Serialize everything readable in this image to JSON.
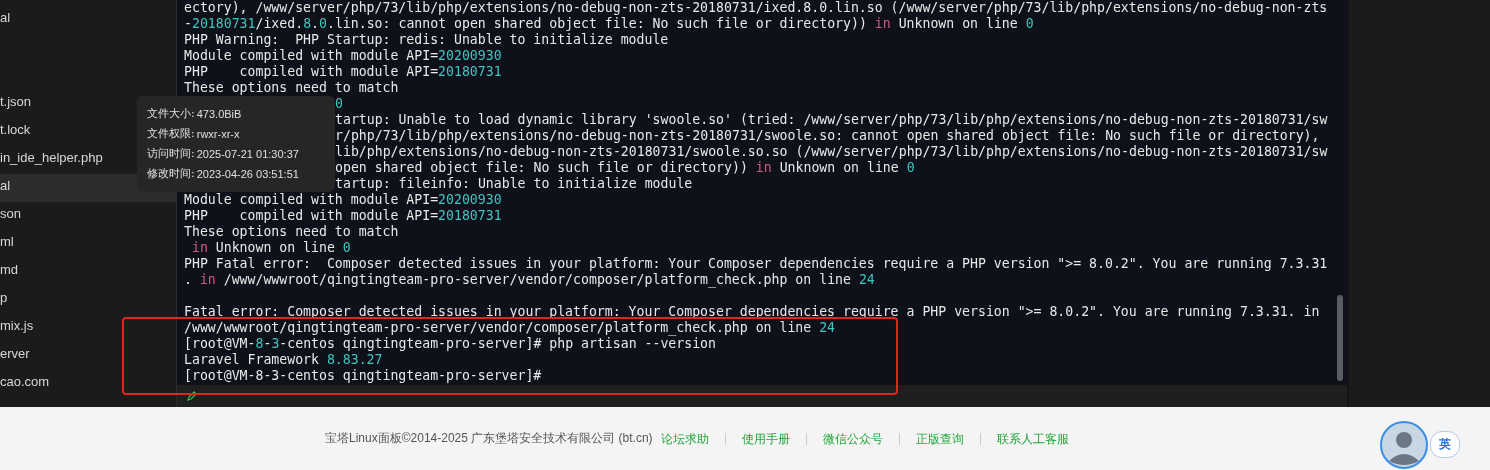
{
  "sidebar": {
    "items": [
      {
        "label": "al",
        "selected": false
      },
      {
        "label": "t.json",
        "selected": false
      },
      {
        "label": "t.lock",
        "selected": false
      },
      {
        "label": "in_ide_helper.php",
        "selected": false
      },
      {
        "label": "al",
        "selected": true
      },
      {
        "label": "son",
        "selected": false
      },
      {
        "label": "ml",
        "selected": false
      },
      {
        "label": "md",
        "selected": false
      },
      {
        "label": "p",
        "selected": false
      },
      {
        "label": "mix.js",
        "selected": false
      },
      {
        "label": "erver",
        "selected": false
      },
      {
        "label": "cao.com",
        "selected": false
      }
    ]
  },
  "terminal": {
    "lines": [
      {
        "kind": "text",
        "segments": [
          {
            "text": "ectory), /www/server/php/73/lib/php/extensions/no-debug-non-zts-20180731/ixed.8.0.lin.so (/www/server/php/73/lib/php/extensions/no-debug-non-zts",
            "kind": "plain"
          }
        ]
      },
      {
        "kind": "text",
        "segments": [
          {
            "text": "-",
            "kind": "plain"
          },
          {
            "text": "20180731",
            "kind": "number"
          },
          {
            "text": "/ixed.",
            "kind": "plain"
          },
          {
            "text": "8",
            "kind": "number"
          },
          {
            "text": ".",
            "kind": "plain"
          },
          {
            "text": "0",
            "kind": "number"
          },
          {
            "text": ".lin.so: cannot open shared object file: No such file or directory)) ",
            "kind": "plain"
          },
          {
            "text": "in",
            "kind": "keyword"
          },
          {
            "text": " Unknown on line ",
            "kind": "plain"
          },
          {
            "text": "0",
            "kind": "number"
          }
        ]
      },
      {
        "kind": "text",
        "segments": [
          {
            "text": "PHP Warning:  PHP Startup: redis: Unable to initialize module",
            "kind": "plain"
          }
        ]
      },
      {
        "kind": "text",
        "segments": [
          {
            "text": "Module compiled with module API=",
            "kind": "plain"
          },
          {
            "text": "20200930",
            "kind": "number"
          }
        ]
      },
      {
        "kind": "text",
        "segments": [
          {
            "text": "PHP    compiled with module API=",
            "kind": "plain"
          },
          {
            "text": "20180731",
            "kind": "number"
          }
        ]
      },
      {
        "kind": "text",
        "segments": [
          {
            "text": "These options need to match",
            "kind": "plain"
          }
        ]
      },
      {
        "kind": "text",
        "under_tooltip": true,
        "segments": [
          {
            "text": "0",
            "kind": "number"
          }
        ]
      },
      {
        "kind": "text",
        "under_tooltip": true,
        "segments": [
          {
            "text": "tartup: Unable to load dynamic library 'swoole.so' (tried: /www/server/php/73/lib/php/extensions/no-debug-non-zts-20180731/sw",
            "kind": "plain"
          }
        ]
      },
      {
        "kind": "text",
        "under_tooltip": true,
        "segments": [
          {
            "text": "r/php/73/lib/php/extensions/no-debug-non-zts-20180731/swoole.so: cannot open shared object file: No such file or directory),",
            "kind": "plain"
          }
        ]
      },
      {
        "kind": "text",
        "under_tooltip": true,
        "segments": [
          {
            "text": "lib/php/extensions/no-debug-non-zts-20180731/swoole.so.so (/www/server/php/73/lib/php/extensions/no-debug-non-zts-20180731/sw",
            "kind": "plain"
          }
        ]
      },
      {
        "kind": "text",
        "under_tooltip": true,
        "segments": [
          {
            "text": "open shared object file: No such file or directory)) ",
            "kind": "plain"
          },
          {
            "text": "in",
            "kind": "keyword"
          },
          {
            "text": " Unknown on line ",
            "kind": "plain"
          },
          {
            "text": "0",
            "kind": "number"
          }
        ]
      },
      {
        "kind": "text",
        "under_tooltip": true,
        "segments": [
          {
            "text": "tartup: fileinfo: Unable to initialize module",
            "kind": "plain"
          }
        ]
      },
      {
        "kind": "text",
        "segments": [
          {
            "text": "Module compiled with module API=",
            "kind": "plain"
          },
          {
            "text": "20200930",
            "kind": "number"
          }
        ]
      },
      {
        "kind": "text",
        "segments": [
          {
            "text": "PHP    compiled with module API=",
            "kind": "plain"
          },
          {
            "text": "20180731",
            "kind": "number"
          }
        ]
      },
      {
        "kind": "text",
        "segments": [
          {
            "text": "These options need to match",
            "kind": "plain"
          }
        ]
      },
      {
        "kind": "text",
        "segments": [
          {
            "text": " in",
            "kind": "keyword"
          },
          {
            "text": " Unknown on line ",
            "kind": "plain"
          },
          {
            "text": "0",
            "kind": "number"
          }
        ]
      },
      {
        "kind": "text",
        "segments": [
          {
            "text": "PHP Fatal error:  Composer detected issues in your platform: Your Composer dependencies require a PHP version \">= 8.0.2\". You are running 7.3.31",
            "kind": "plain"
          }
        ]
      },
      {
        "kind": "text",
        "segments": [
          {
            "text": ". ",
            "kind": "plain"
          },
          {
            "text": "in",
            "kind": "keyword"
          },
          {
            "text": " /www/wwwroot/qingtingteam-pro-server/vendor/composer/platform_check.php on line ",
            "kind": "plain"
          },
          {
            "text": "24",
            "kind": "number"
          }
        ]
      },
      {
        "kind": "blank"
      },
      {
        "kind": "text",
        "segments": [
          {
            "text": "Fatal error: Composer detected issues in your platform: Your Composer dependencies require a PHP version \">= 8.0.2\". You are running 7.3.31. in",
            "kind": "plain"
          }
        ]
      },
      {
        "kind": "text",
        "segments": [
          {
            "text": "/www/wwwroot/qingtingteam-pro-server/vendor/composer/platform_check.php on line ",
            "kind": "plain"
          },
          {
            "text": "24",
            "kind": "number"
          }
        ]
      },
      {
        "kind": "text",
        "segments": [
          {
            "text": "[root@VM-",
            "kind": "plain"
          },
          {
            "text": "8",
            "kind": "number"
          },
          {
            "text": "-",
            "kind": "plain"
          },
          {
            "text": "3",
            "kind": "number"
          },
          {
            "text": "-centos qingtingteam-pro-server]# php artisan --version",
            "kind": "plain"
          }
        ]
      },
      {
        "kind": "text",
        "segments": [
          {
            "text": "Laravel Framework ",
            "kind": "plain"
          },
          {
            "text": "8.83.27",
            "kind": "number"
          }
        ]
      },
      {
        "kind": "text",
        "segments": [
          {
            "text": "[root@VM-8-3-centos qingtingteam-pro-server]#",
            "kind": "plain"
          }
        ]
      }
    ]
  },
  "tooltip": {
    "rows": [
      {
        "label": "文件大小:",
        "value": "473.0BiB"
      },
      {
        "label": "文件权限:",
        "value": "rwxr-xr-x"
      },
      {
        "label": "访问时间:",
        "value": "2025-07-21 01:30:37"
      },
      {
        "label": "修改时间:",
        "value": "2023-04-26 03:51:51"
      }
    ]
  },
  "highlight_box": {
    "kind": "rectangle"
  },
  "footer": {
    "copyright": "宝塔Linux面板©2014-2025 广东堡塔安全技术有限公司 (bt.cn)",
    "links": [
      "论坛求助",
      "使用手册",
      "微信公众号",
      "正版查询",
      "联系人工客服"
    ],
    "language_badge": "英"
  }
}
